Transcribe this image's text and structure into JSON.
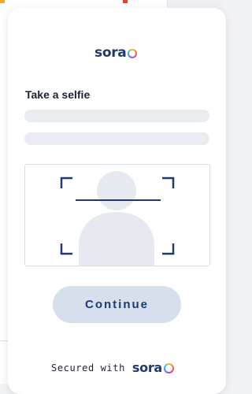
{
  "brand": {
    "name": "sora",
    "text_color": "#1f3a6e"
  },
  "selfie_step": {
    "title": "Take a selfie",
    "continue_label": "Continue",
    "continue_color": "#d6e0ec"
  },
  "footer": {
    "secured_with": "Secured with",
    "brand_name": "sora"
  },
  "icons": {
    "face_frame": "selfie-silhouette-icon",
    "brand_mark": "sora-ring-logo"
  }
}
